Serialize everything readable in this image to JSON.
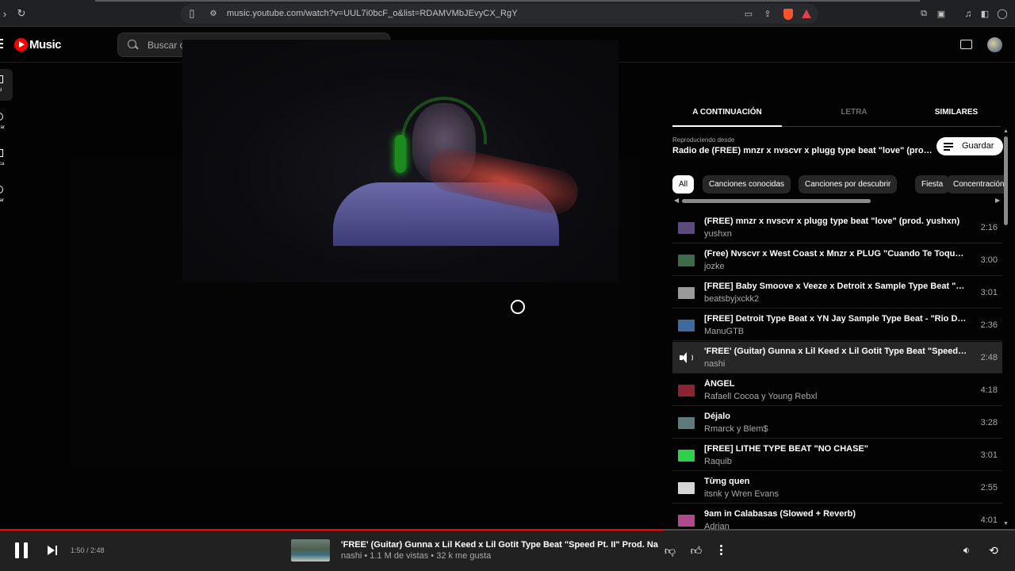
{
  "browser": {
    "url": "music.youtube.com/watch?v=UUL7i0bcF_o&list=RDAMVMbJEvyCX_RgY"
  },
  "header": {
    "logo_text": "Music",
    "search_placeholder": "Buscar c"
  },
  "sidebar": {
    "items": [
      {
        "label": "pal",
        "icon": "home-icon"
      },
      {
        "label": "lorar",
        "icon": "explore-icon"
      },
      {
        "label": "teca",
        "icon": "library-icon"
      },
      {
        "label": "lizar",
        "icon": "upgrade-icon"
      }
    ]
  },
  "panel": {
    "tabs": [
      "A CONTINUACIÓN",
      "LETRA",
      "SIMILARES"
    ],
    "playing_from_label": "Reproduciendo desde",
    "playing_from": "Radio de (FREE) mnzr x nvscvr x plugg type beat \"love\" (prod. yushxn)",
    "save_label": "Guardar",
    "chips": [
      "All",
      "Canciones conocidas",
      "Canciones por descubrir",
      "Fiesta",
      "Concentración"
    ]
  },
  "queue": [
    {
      "title": "(FREE) mnzr x nvscvr x plugg type beat \"love\" (prod. yushxn)",
      "artist": "yushxn",
      "duration": "2:16",
      "thumb_color": "#5b4a7a"
    },
    {
      "title": "(Free) Nvscvr x West Coast x Mnzr x PLUG \"Cuando Te Toque\" | Prod. jozke",
      "artist": "jozke",
      "duration": "3:00",
      "thumb_color": "#3d6b4a"
    },
    {
      "title": "[FREE] Baby Smoove x Veeze x Detroit x Sample Type Beat \"Blue Flame\"",
      "artist": "beatsbyjxckk2",
      "duration": "3:01",
      "thumb_color": "#9a9a9a"
    },
    {
      "title": "[FREE] Detroit Type Beat x YN Jay Sample Type Beat - \"Rio De Janeiro\"",
      "artist": "ManuGTB",
      "duration": "2:36",
      "thumb_color": "#3f6a9e"
    },
    {
      "title": "'FREE' (Guitar) Gunna x Lil Keed x Lil Gotit Type Beat \"Speed Pt. II\" Prod. Nashi",
      "artist": "nashi",
      "duration": "2:48",
      "current": true
    },
    {
      "title": "ÁNGEL",
      "artist": "Rafaell Cocoa y Young Rebxl",
      "duration": "4:18",
      "thumb_color": "#8a2433"
    },
    {
      "title": "Déjalo",
      "artist": "Rmarck y Blem$",
      "duration": "3:28",
      "thumb_color": "#5e7a7a"
    },
    {
      "title": "[FREE] LITHE TYPE BEAT \"NO CHASE\"",
      "artist": "Raquib",
      "duration": "3:01",
      "thumb_color": "#2fcf4a"
    },
    {
      "title": "Từng quen",
      "artist": "itsnk y Wren Evans",
      "duration": "2:55",
      "thumb_color": "#d6d6d6"
    },
    {
      "title": "9am in Calabasas (Slowed + Reverb)",
      "artist": "Adrian",
      "duration": "4:01",
      "thumb_color": "#b04a8e"
    }
  ],
  "player": {
    "time": "1:50 / 2:48",
    "progress_fraction": 0.655,
    "title": "'FREE' (Guitar) Gunna x Lil Keed x Lil Gotit Type Beat \"Speed Pt. II\" Prod. Nashi",
    "subtitle": "nashi • 1.1 M de vistas • 32 k me gusta"
  }
}
